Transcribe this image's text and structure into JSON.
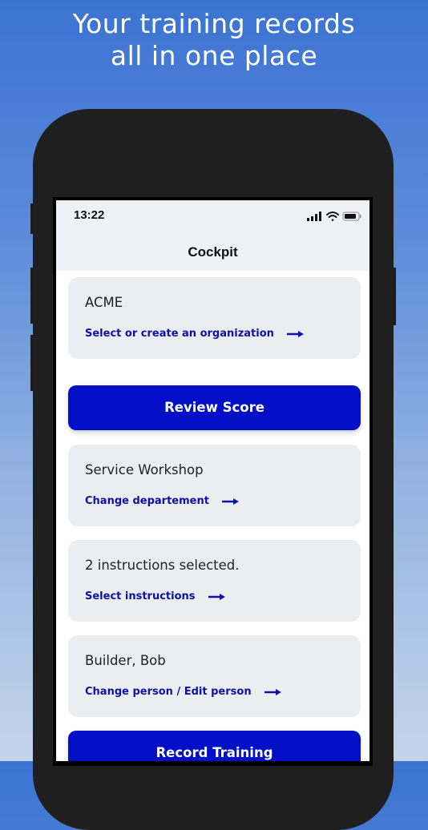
{
  "headline": {
    "line1": "Your training records",
    "line2": "all in one place"
  },
  "status_bar": {
    "time": "13:22",
    "icons": [
      "cellular-signal-icon",
      "wifi-icon",
      "battery-icon"
    ]
  },
  "nav": {
    "title": "Cockpit"
  },
  "cards": {
    "organization": {
      "title": "ACME",
      "link": "Select or create an organization"
    },
    "department": {
      "title": "Service Workshop",
      "link": "Change departement"
    },
    "instructions": {
      "title": "2 instructions selected.",
      "link": "Select instructions"
    },
    "person": {
      "title": "Builder, Bob",
      "link": "Change person / Edit person"
    }
  },
  "buttons": {
    "review": "Review Score",
    "record": "Record Training"
  },
  "colors": {
    "accent": "#0410c8",
    "link": "#0d12a8",
    "card_bg": "#ecedf1",
    "background_top": "#3c73d2"
  }
}
